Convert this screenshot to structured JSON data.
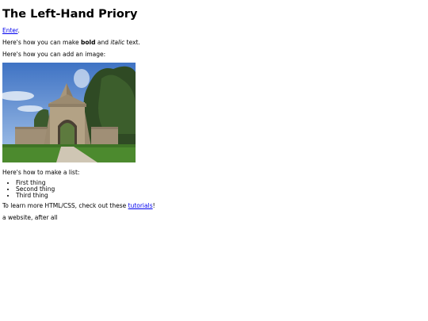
{
  "title": "The Left-Hand Priory",
  "enter_link": "Enter",
  "enter_suffix": ".",
  "bold_line": {
    "before": "Here's how you can make ",
    "bold": "bold",
    "middle": " and ",
    "italic": "italic",
    "after": " text."
  },
  "image_intro": "Here's how you can add an image:",
  "image": {
    "subject": "stone archway gatehouse with pyramid top under blue sky",
    "colors": {
      "sky": "#5b8fd0",
      "stone": "#9c8e78",
      "grass": "#4c8a2e",
      "trees": "#2f4a24"
    }
  },
  "list_intro": "Here's how to make a list:",
  "list_items": [
    "First thing",
    "Second thing",
    "Third thing"
  ],
  "learn": {
    "before": "To learn more HTML/CSS, check out these ",
    "link": "tutorials",
    "after": "!"
  },
  "footer_text": "a website, after all"
}
